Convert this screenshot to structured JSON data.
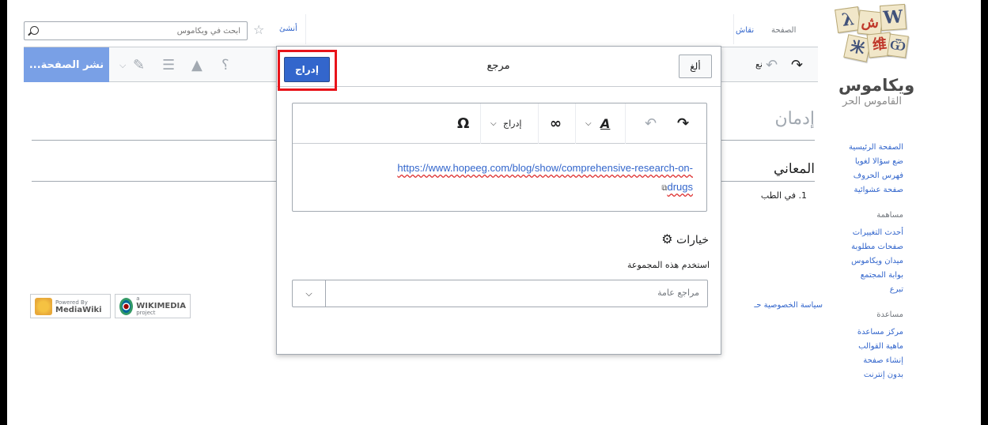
{
  "sidebar": {
    "logo_text": "ويكاموس",
    "logo_tagline": "القاموس الحر",
    "logo_tiles": [
      "λ",
      "ش",
      "W",
      "米",
      "维",
      "Ѿ"
    ],
    "nav": [
      "الصفحة الرئيسية",
      "ضع سؤالا لغويا",
      "فهرس الحروف",
      "صفحة عشوائية"
    ],
    "contribute_heading": "مساهمة",
    "contribute": [
      "أحدث التغييرات",
      "صفحات مطلوبة",
      "ميدان ويكاموس",
      "بوابة المجتمع",
      "تبرع"
    ],
    "help_heading": "مساعدة",
    "help": [
      "مركز مساعدة",
      "ماهية القوالب",
      "إنشاء صفحة",
      "بدون إنترنت"
    ]
  },
  "topbar": {
    "search_placeholder": "ابحث في ويكاموس",
    "create_tab": "أنشئ",
    "talk_tab": "نقاش",
    "page_tab": "الصفحة"
  },
  "toolbar": {
    "publish_label": "نشر الصفحة...",
    "partial_text": "نع"
  },
  "page": {
    "title": "إدمان",
    "section": "المعاني",
    "definition": "1. في الطب"
  },
  "footer": {
    "links": "سياسة الخصوصية  حـ",
    "mediawiki_small": "Powered By",
    "mediawiki_big": "MediaWiki",
    "wikimedia_small": "a",
    "wikimedia_big": "WIKIMEDIA",
    "wikimedia_sub": "project"
  },
  "dialog": {
    "title": "مرجع",
    "insert_label": "إدراج",
    "cancel_label": "ألغ",
    "editor_insert_menu": "إدراج",
    "reference_url": "https://www.hopeeg.com/blog/show/comprehensive-research-on-",
    "reference_url_end": "drugs",
    "options_title": "خيارات",
    "group_label": "استخدم هذه المجموعة",
    "group_value": "مراجع عامة"
  },
  "colors": {
    "accent": "#3366cc",
    "publish": "#79a0e6",
    "highlight": "#e8141a"
  }
}
